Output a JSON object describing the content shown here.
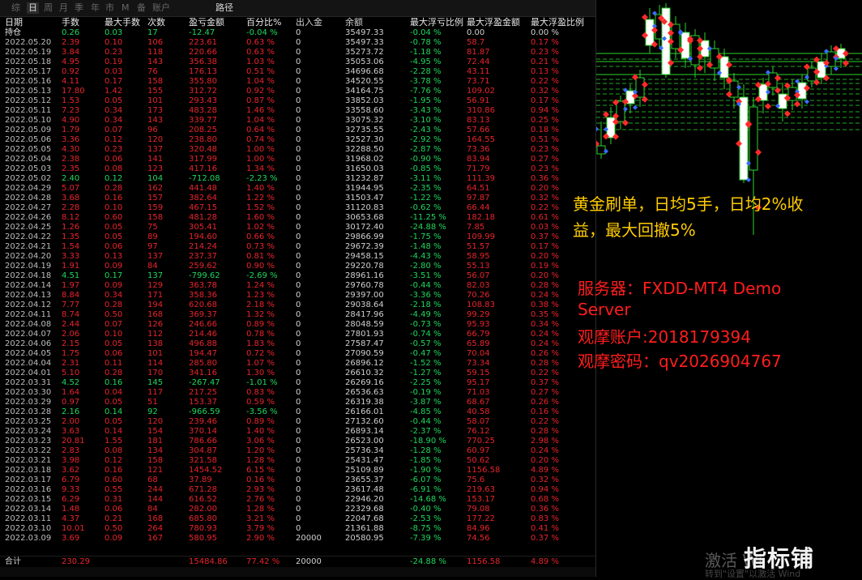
{
  "tabs": [
    "综",
    "日",
    "周",
    "月",
    "季",
    "年",
    "市",
    "M",
    "备",
    "账户",
    "路径"
  ],
  "active_tab": "日",
  "headers": [
    "日期",
    "手数",
    "最大手数",
    "次数",
    "盈亏金额",
    "百分比%",
    "出入金",
    "余额",
    "最大浮亏比例",
    "最大浮盈金额",
    "最大浮盈比例"
  ],
  "holding": {
    "label": "持仓",
    "lots": "0.26",
    "max_lots": "0.03",
    "count": "17",
    "pnl": "-12.47",
    "pct": "-0.04 %",
    "deposit": "0",
    "balance": "35497.33",
    "max_dd": "-0.04 %",
    "max_float_profit": "0.00",
    "max_float_pct": "0.00 %"
  },
  "rows": [
    [
      "2022.05.20",
      "2.39",
      "0.10",
      "106",
      "223.61",
      "0.63 %",
      "0",
      "35497.33",
      "-0.78 %",
      "58.7",
      "0.17 %"
    ],
    [
      "2022.05.19",
      "3.84",
      "0.23",
      "118",
      "220.66",
      "0.63 %",
      "0",
      "35273.72",
      "-1.18 %",
      "81.87",
      "0.23 %"
    ],
    [
      "2022.05.18",
      "4.95",
      "0.19",
      "143",
      "356.38",
      "1.03 %",
      "0",
      "35053.06",
      "-4.95 %",
      "72.44",
      "0.21 %"
    ],
    [
      "2022.05.17",
      "0.92",
      "0.03",
      "76",
      "176.13",
      "0.51 %",
      "0",
      "34696.68",
      "-2.28 %",
      "43.11",
      "0.13 %"
    ],
    [
      "2022.05.16",
      "4.11",
      "0.17",
      "158",
      "355.80",
      "1.04 %",
      "0",
      "34520.55",
      "-3.78 %",
      "73.71",
      "0.22 %"
    ],
    [
      "2022.05.13",
      "17.80",
      "1.42",
      "155",
      "312.72",
      "0.92 %",
      "0",
      "34164.75",
      "-7.76 %",
      "109.02",
      "0.32 %"
    ],
    [
      "2022.05.12",
      "1.53",
      "0.05",
      "101",
      "293.43",
      "0.87 %",
      "0",
      "33852.03",
      "-1.95 %",
      "56.91",
      "0.17 %"
    ],
    [
      "2022.05.11",
      "7.23",
      "0.34",
      "173",
      "483.28",
      "1.46 %",
      "0",
      "33558.60",
      "-3.43 %",
      "310.86",
      "0.94 %"
    ],
    [
      "2022.05.10",
      "4.90",
      "0.34",
      "143",
      "339.77",
      "1.04 %",
      "0",
      "33075.32",
      "-3.10 %",
      "83.13",
      "0.25 %"
    ],
    [
      "2022.05.09",
      "1.79",
      "0.07",
      "96",
      "208.25",
      "0.64 %",
      "0",
      "32735.55",
      "-2.43 %",
      "57.66",
      "0.18 %"
    ],
    [
      "2022.05.06",
      "3.36",
      "0.12",
      "120",
      "238.80",
      "0.74 %",
      "0",
      "32527.30",
      "-2.92 %",
      "164.55",
      "0.51 %"
    ],
    [
      "2022.05.05",
      "4.30",
      "0.23",
      "137",
      "320.48",
      "1.00 %",
      "0",
      "32288.50",
      "-2.87 %",
      "73.36",
      "0.23 %"
    ],
    [
      "2022.05.04",
      "2.38",
      "0.06",
      "141",
      "317.99",
      "1.00 %",
      "0",
      "31968.02",
      "-0.90 %",
      "83.94",
      "0.27 %"
    ],
    [
      "2022.05.03",
      "2.35",
      "0.08",
      "123",
      "417.16",
      "1.34 %",
      "0",
      "31650.03",
      "-0.85 %",
      "71.79",
      "0.23 %"
    ],
    [
      "2022.05.02",
      "2.40",
      "0.12",
      "104",
      "-712.08",
      "-2.23 %",
      "0",
      "31232.87",
      "-3.11 %",
      "111.39",
      "0.36 %"
    ],
    [
      "2022.04.29",
      "5.07",
      "0.28",
      "162",
      "441.48",
      "1.40 %",
      "0",
      "31944.95",
      "-2.35 %",
      "64.51",
      "0.20 %"
    ],
    [
      "2022.04.28",
      "3.68",
      "0.16",
      "157",
      "382.64",
      "1.22 %",
      "0",
      "31503.47",
      "-1.22 %",
      "97.87",
      "0.32 %"
    ],
    [
      "2022.04.27",
      "2.28",
      "0.10",
      "159",
      "467.15",
      "1.52 %",
      "0",
      "31120.83",
      "-0.62 %",
      "66.44",
      "0.22 %"
    ],
    [
      "2022.04.26",
      "8.12",
      "0.60",
      "158",
      "481.28",
      "1.60 %",
      "0",
      "30653.68",
      "-11.25 %",
      "182.18",
      "0.61 %"
    ],
    [
      "2022.04.25",
      "1.26",
      "0.05",
      "75",
      "305.41",
      "1.02 %",
      "0",
      "30172.40",
      "-24.88 %",
      "7.85",
      "0.03 %"
    ],
    [
      "2022.04.22",
      "1.35",
      "0.05",
      "89",
      "194.60",
      "0.66 %",
      "0",
      "29866.99",
      "-1.75 %",
      "109.99",
      "0.37 %"
    ],
    [
      "2022.04.21",
      "1.54",
      "0.06",
      "97",
      "214.24",
      "0.73 %",
      "0",
      "29672.39",
      "-1.48 %",
      "51.57",
      "0.17 %"
    ],
    [
      "2022.04.20",
      "3.33",
      "0.13",
      "137",
      "237.37",
      "0.81 %",
      "0",
      "29458.15",
      "-4.43 %",
      "58.95",
      "0.20 %"
    ],
    [
      "2022.04.19",
      "1.91",
      "0.09",
      "84",
      "259.62",
      "0.90 %",
      "0",
      "29220.78",
      "-2.80 %",
      "55.13",
      "0.19 %"
    ],
    [
      "2022.04.18",
      "4.51",
      "0.17",
      "137",
      "-799.62",
      "-2.69 %",
      "0",
      "28961.16",
      "-3.51 %",
      "56.07",
      "0.20 %"
    ],
    [
      "2022.04.14",
      "1.97",
      "0.09",
      "129",
      "363.78",
      "1.24 %",
      "0",
      "29760.78",
      "-0.44 %",
      "82.03",
      "0.28 %"
    ],
    [
      "2022.04.13",
      "8.84",
      "0.34",
      "171",
      "358.36",
      "1.23 %",
      "0",
      "29397.00",
      "-3.36 %",
      "70.26",
      "0.24 %"
    ],
    [
      "2022.04.12",
      "7.77",
      "0.28",
      "194",
      "620.68",
      "2.18 %",
      "0",
      "29038.64",
      "-2.18 %",
      "108.83",
      "0.38 %"
    ],
    [
      "2022.04.11",
      "8.74",
      "0.50",
      "168",
      "369.37",
      "1.32 %",
      "0",
      "28417.96",
      "-4.49 %",
      "99.29",
      "0.35 %"
    ],
    [
      "2022.04.08",
      "2.44",
      "0.07",
      "126",
      "246.66",
      "0.89 %",
      "0",
      "28048.59",
      "-0.73 %",
      "95.93",
      "0.34 %"
    ],
    [
      "2022.04.07",
      "2.06",
      "0.10",
      "112",
      "214.46",
      "0.78 %",
      "0",
      "27801.93",
      "-0.74 %",
      "66.79",
      "0.24 %"
    ],
    [
      "2022.04.06",
      "2.15",
      "0.05",
      "138",
      "496.88",
      "1.83 %",
      "0",
      "27587.47",
      "-0.57 %",
      "65.89",
      "0.24 %"
    ],
    [
      "2022.04.05",
      "1.75",
      "0.06",
      "101",
      "194.47",
      "0.72 %",
      "0",
      "27090.59",
      "-0.47 %",
      "70.04",
      "0.26 %"
    ],
    [
      "2022.04.04",
      "2.31",
      "0.11",
      "114",
      "285.80",
      "1.07 %",
      "0",
      "26896.12",
      "-1.52 %",
      "73.34",
      "0.28 %"
    ],
    [
      "2022.04.01",
      "5.10",
      "0.28",
      "170",
      "341.16",
      "1.30 %",
      "0",
      "26610.32",
      "-1.27 %",
      "59.15",
      "0.22 %"
    ],
    [
      "2022.03.31",
      "4.52",
      "0.16",
      "145",
      "-267.47",
      "-1.01 %",
      "0",
      "26269.16",
      "-2.25 %",
      "95.17",
      "0.37 %"
    ],
    [
      "2022.03.30",
      "1.64",
      "0.04",
      "117",
      "217.25",
      "0.83 %",
      "0",
      "26536.63",
      "-0.19 %",
      "71.03",
      "0.27 %"
    ],
    [
      "2022.03.29",
      "0.97",
      "0.05",
      "51",
      "153.37",
      "0.59 %",
      "0",
      "26319.38",
      "-3.87 %",
      "68.67",
      "0.26 %"
    ],
    [
      "2022.03.28",
      "2.16",
      "0.14",
      "92",
      "-966.59",
      "-3.56 %",
      "0",
      "26166.01",
      "-4.85 %",
      "40.58",
      "0.16 %"
    ],
    [
      "2022.03.25",
      "2.00",
      "0.05",
      "120",
      "239.46",
      "0.89 %",
      "0",
      "27132.60",
      "-0.44 %",
      "58.07",
      "0.22 %"
    ],
    [
      "2022.03.24",
      "3.63",
      "0.14",
      "154",
      "370.14",
      "1.40 %",
      "0",
      "26893.14",
      "-2.37 %",
      "76.12",
      "0.28 %"
    ],
    [
      "2022.03.23",
      "20.81",
      "1.55",
      "181",
      "786.66",
      "3.06 %",
      "0",
      "26523.00",
      "-18.90 %",
      "770.25",
      "2.98 %"
    ],
    [
      "2022.03.22",
      "2.83",
      "0.08",
      "134",
      "304.87",
      "1.20 %",
      "0",
      "25736.34",
      "-1.28 %",
      "60.97",
      "0.24 %"
    ],
    [
      "2022.03.21",
      "3.98",
      "0.12",
      "158",
      "321.58",
      "1.28 %",
      "0",
      "25431.47",
      "-1.85 %",
      "50.62",
      "0.20 %"
    ],
    [
      "2022.03.18",
      "3.62",
      "0.16",
      "121",
      "1454.52",
      "6.15 %",
      "0",
      "25109.89",
      "-1.90 %",
      "1156.58",
      "4.89 %"
    ],
    [
      "2022.03.17",
      "6.79",
      "0.60",
      "68",
      "37.89",
      "0.16 %",
      "0",
      "23655.37",
      "-6.07 %",
      "75.6",
      "0.32 %"
    ],
    [
      "2022.03.16",
      "9.33",
      "0.55",
      "244",
      "671.28",
      "2.93 %",
      "0",
      "23617.48",
      "-6.91 %",
      "219.63",
      "0.94 %"
    ],
    [
      "2022.03.15",
      "6.29",
      "0.31",
      "144",
      "616.52",
      "2.76 %",
      "0",
      "22946.20",
      "-14.68 %",
      "153.17",
      "0.68 %"
    ],
    [
      "2022.03.14",
      "1.48",
      "0.06",
      "84",
      "282.00",
      "1.28 %",
      "0",
      "22329.68",
      "-0.40 %",
      "79.08",
      "0.36 %"
    ],
    [
      "2022.03.11",
      "4.37",
      "0.21",
      "168",
      "685.80",
      "3.21 %",
      "0",
      "22047.68",
      "-2.53 %",
      "177.22",
      "0.83 %"
    ],
    [
      "2022.03.10",
      "10.01",
      "0.50",
      "264",
      "780.93",
      "3.79 %",
      "0",
      "21361.88",
      "-8.75 %",
      "84.96",
      "0.41 %"
    ],
    [
      "2022.03.09",
      "3.69",
      "0.09",
      "167",
      "580.95",
      "2.90 %",
      "20000",
      "20580.95",
      "-7.39 %",
      "74.56",
      "0.37 %"
    ]
  ],
  "total": {
    "label": "合计",
    "lots": "230.29",
    "max_lots": "",
    "count": "",
    "pnl": "15484.86",
    "pct": "77.42 %",
    "deposit": "20000",
    "balance": "",
    "max_dd": "-24.88 %",
    "max_float_profit": "1156.58",
    "max_float_pct": "4.89 %"
  },
  "annotation": {
    "line1": "黄金刷单，日均5手，日均2%收",
    "line2": "益，最大回撤5%"
  },
  "server": {
    "line1": "服务器：FXDD-MT4 Demo",
    "line2": "Server",
    "account": "观摩账户:2018179394",
    "password": "观摩密码：qv2026904767"
  },
  "watermark": "指标铺",
  "windows_activation": {
    "line1": "激活 Wi",
    "line2": "转到\"设置\"以激活 Wind"
  },
  "colors": {
    "profit": "#e8242c",
    "loss": "#1fd75d",
    "annotation": "#ffcc00",
    "server": "#ff1d1d",
    "bg": "#000000"
  }
}
